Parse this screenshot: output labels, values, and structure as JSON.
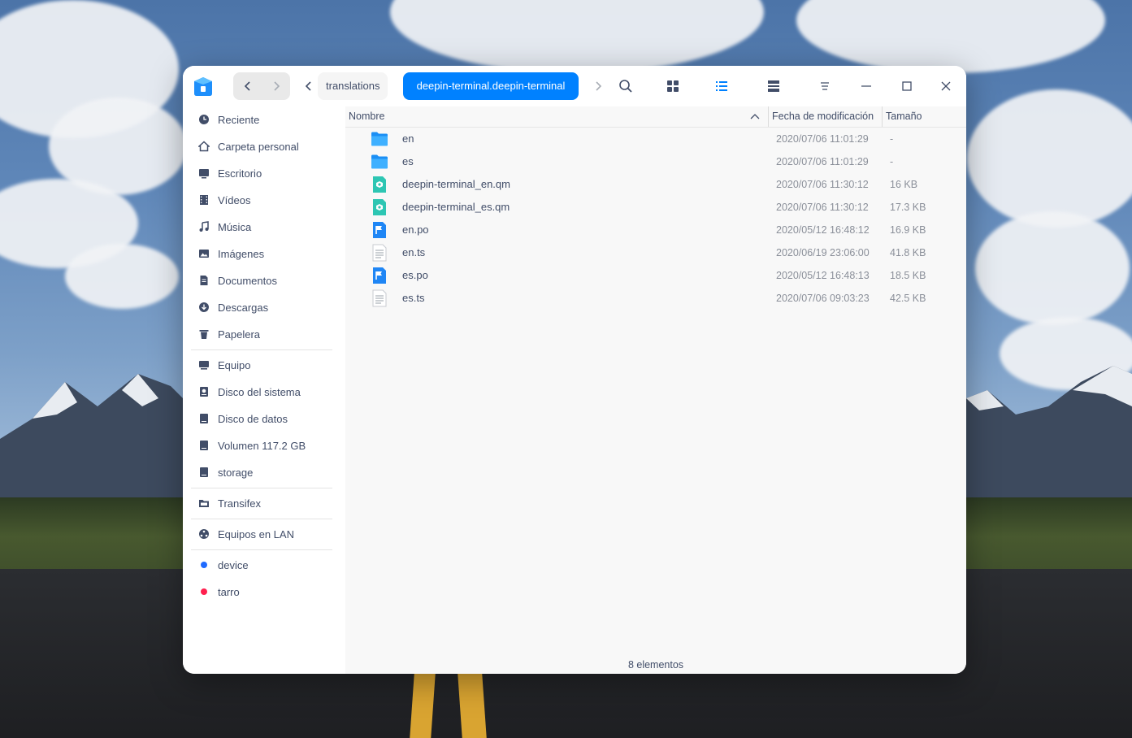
{
  "toolbar": {
    "breadcrumb_parent": "translations",
    "breadcrumb_current": "deepin-terminal.deepin-terminal",
    "accent": "#0081ff"
  },
  "sidebar": {
    "items": [
      {
        "label": "Reciente",
        "icon": "clock-icon"
      },
      {
        "label": "Carpeta personal",
        "icon": "home-icon"
      },
      {
        "label": "Escritorio",
        "icon": "desktop-icon"
      },
      {
        "label": "Vídeos",
        "icon": "film-icon"
      },
      {
        "label": "Música",
        "icon": "music-icon"
      },
      {
        "label": "Imágenes",
        "icon": "image-icon"
      },
      {
        "label": "Documentos",
        "icon": "document-icon"
      },
      {
        "label": "Descargas",
        "icon": "download-icon"
      },
      {
        "label": "Papelera",
        "icon": "trash-icon"
      }
    ],
    "devices": [
      {
        "label": "Equipo",
        "icon": "computer-icon"
      },
      {
        "label": "Disco del sistema",
        "icon": "system-disk-icon"
      },
      {
        "label": "Disco de datos",
        "icon": "disk-icon"
      },
      {
        "label": "Volumen 117.2 GB",
        "icon": "disk-icon"
      },
      {
        "label": "storage",
        "icon": "disk-icon"
      }
    ],
    "transifex": {
      "label": "Transifex",
      "icon": "folder-icon"
    },
    "network": {
      "label": "Equipos en LAN",
      "icon": "network-icon"
    },
    "tags": [
      {
        "label": "device",
        "color": "#1f6bff"
      },
      {
        "label": "tarro",
        "color": "#ff1f4e"
      }
    ]
  },
  "columns": {
    "name": "Nombre",
    "date": "Fecha de modificación",
    "size": "Tamaño"
  },
  "files": [
    {
      "name": "en",
      "date": "2020/07/06 11:01:29",
      "size": "-",
      "icon": "folder-icon"
    },
    {
      "name": "es",
      "date": "2020/07/06 11:01:29",
      "size": "-",
      "icon": "folder-icon"
    },
    {
      "name": "deepin-terminal_en.qm",
      "date": "2020/07/06 11:30:12",
      "size": "16 KB",
      "icon": "qm-file-icon"
    },
    {
      "name": "deepin-terminal_es.qm",
      "date": "2020/07/06 11:30:12",
      "size": "17.3 KB",
      "icon": "qm-file-icon"
    },
    {
      "name": "en.po",
      "date": "2020/05/12 16:48:12",
      "size": "16.9 KB",
      "icon": "po-file-icon"
    },
    {
      "name": "en.ts",
      "date": "2020/06/19 23:06:00",
      "size": "41.8 KB",
      "icon": "text-file-icon"
    },
    {
      "name": "es.po",
      "date": "2020/05/12 16:48:13",
      "size": "18.5 KB",
      "icon": "po-file-icon"
    },
    {
      "name": "es.ts",
      "date": "2020/07/06 09:03:23",
      "size": "42.5 KB",
      "icon": "text-file-icon"
    }
  ],
  "status": {
    "count": "8 elementos"
  }
}
